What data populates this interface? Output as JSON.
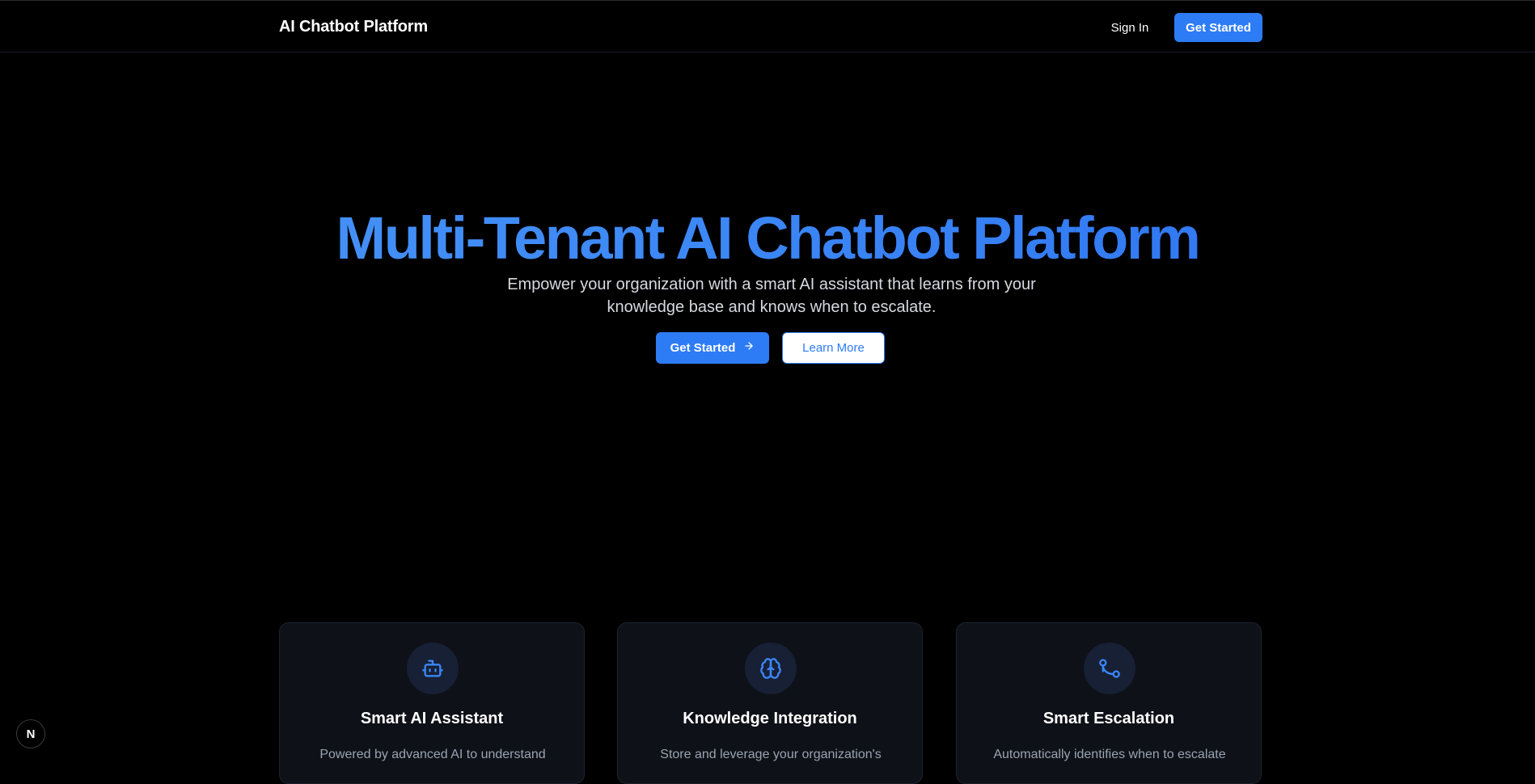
{
  "header": {
    "brand": "AI Chatbot Platform",
    "sign_in": "Sign In",
    "get_started": "Get Started"
  },
  "hero": {
    "title": "Multi-Tenant AI Chatbot Platform",
    "subtitle": "Empower your organization with a smart AI assistant that learns from your knowledge base and knows when to escalate.",
    "primary_cta": "Get Started",
    "secondary_cta": "Learn More"
  },
  "features": [
    {
      "icon": "bot-icon",
      "title": "Smart AI Assistant",
      "description": "Powered by advanced AI to understand"
    },
    {
      "icon": "brain-icon",
      "title": "Knowledge Integration",
      "description": "Store and leverage your organization's"
    },
    {
      "icon": "git-branch-icon",
      "title": "Smart Escalation",
      "description": "Automatically identifies when to escalate"
    }
  ],
  "badge": {
    "label": "N"
  },
  "colors": {
    "accent": "#2d7cf6",
    "background": "#000000",
    "card": "#0e1117"
  }
}
